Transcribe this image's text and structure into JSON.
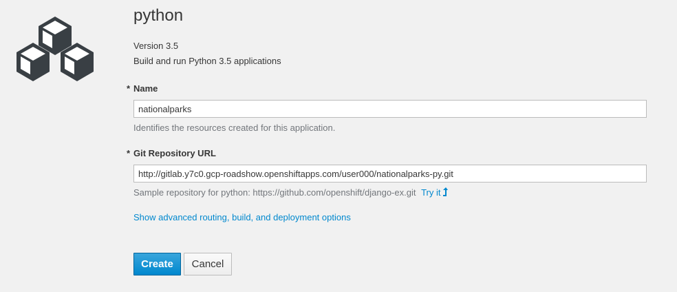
{
  "app": {
    "title": "python",
    "version": "Version 3.5",
    "description": "Build and run Python 3.5 applications",
    "logo_icon": "python-cubes-icon"
  },
  "form": {
    "name": {
      "required_marker": "*",
      "label": "Name",
      "value": "nationalparks",
      "help": "Identifies the resources created for this application."
    },
    "git_url": {
      "required_marker": "*",
      "label": "Git Repository URL",
      "value": "http://gitlab.y7c0.gcp-roadshow.openshiftapps.com/user000/nationalparks-py.git",
      "help": "Sample repository for python: https://github.com/openshift/django-ex.git",
      "try_it": "Try it",
      "try_it_icon": "level-up-arrow-icon"
    },
    "advanced_link": "Show advanced routing, build, and deployment options"
  },
  "buttons": {
    "create": "Create",
    "cancel": "Cancel"
  },
  "colors": {
    "background": "#f1f1f1",
    "link": "#0088ce",
    "primary": "#0088ce",
    "text": "#363636",
    "help_text": "#72767b",
    "logo": "#393f44"
  }
}
